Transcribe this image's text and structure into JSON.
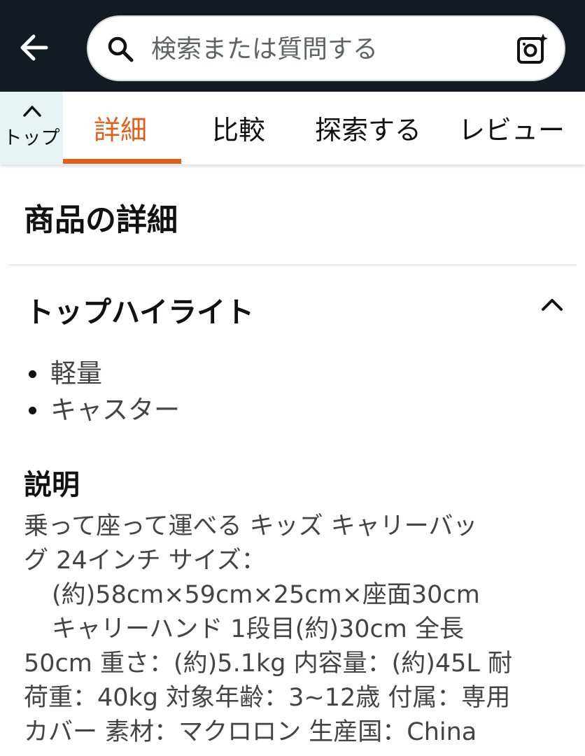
{
  "header": {
    "search_placeholder": "検索または質問する"
  },
  "tabs": {
    "top_label": "トップ",
    "items": [
      "詳細",
      "比較",
      "探索する",
      "レビュー"
    ],
    "active": "詳細"
  },
  "main": {
    "title": "商品の詳細",
    "highlights": {
      "title": "トップハイライト",
      "items": [
        "軽量",
        "キャスター"
      ]
    },
    "description": {
      "title": "説明",
      "lines": [
        "乗って座って運べる キッズ キャリーバッ",
        "グ 24インチ サイズ：",
        "(約)58cm×59cm×25cm×座面30cm",
        "キャリーハンド 1段目(約)30cm 全長",
        "50cm 重さ：(約)5.1kg 内容量：(約)45L 耐",
        "荷重：40kg 対象年齢：3~12歳 付属：専用",
        "カバー 素材：マクロロン 生産国：China"
      ]
    }
  },
  "colors": {
    "header_bg": "#131a22",
    "accent": "#e25f1a",
    "top_button_bg": "#e8f4f3"
  },
  "icons": [
    "back-arrow-icon",
    "search-icon",
    "camera-search-icon",
    "chevron-up-icon",
    "collapse-chevron-icon"
  ]
}
